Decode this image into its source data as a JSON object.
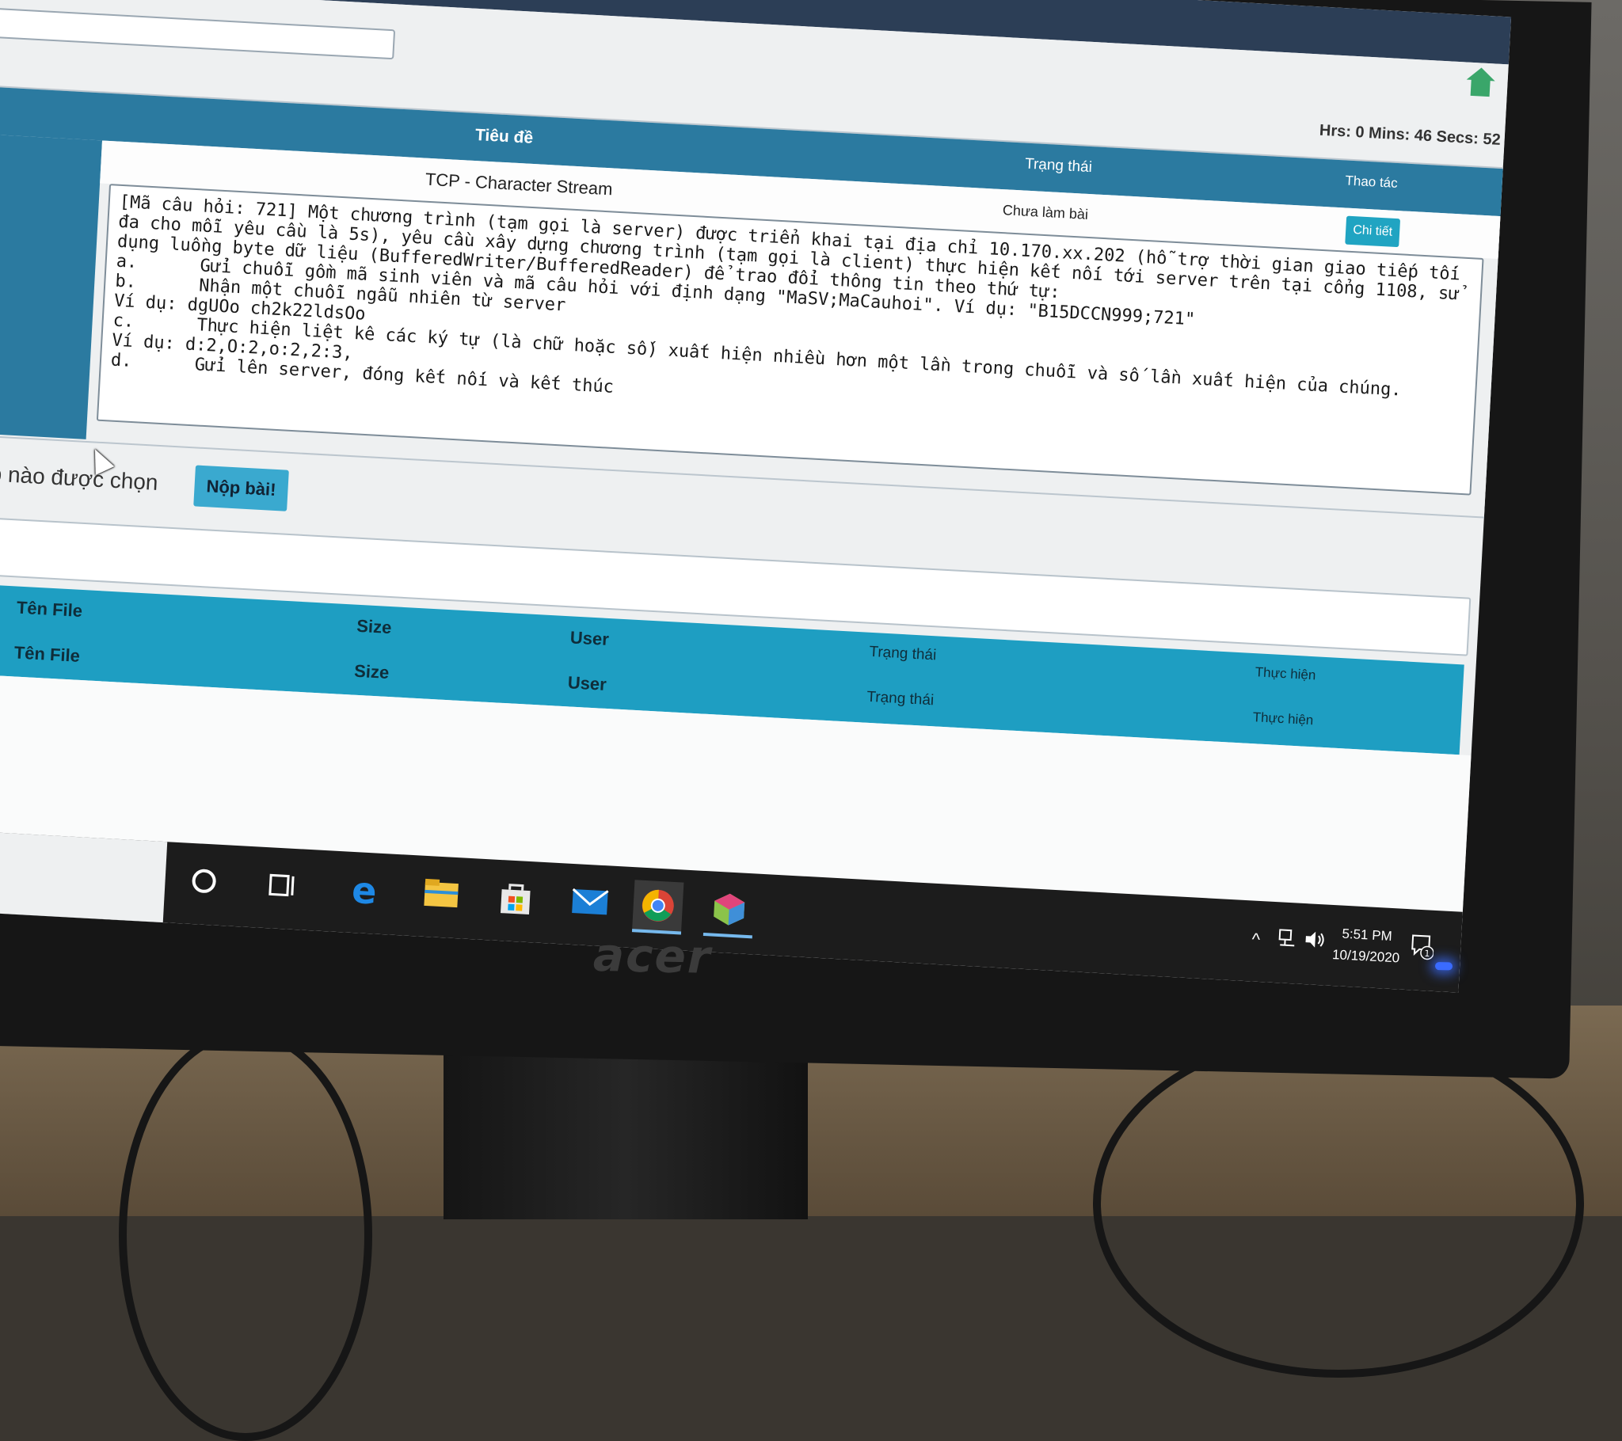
{
  "monitor": {
    "brand": "acer"
  },
  "page": {
    "timer": "Hrs: 0 Mins: 46 Secs: 52",
    "questions_table": {
      "columns": {
        "title": "Tiêu đề",
        "status": "Trạng thái",
        "action": "Thao tác"
      },
      "row": {
        "title": "TCP - Character Stream",
        "status": "Chưa làm bài",
        "detail_button": "Chi tiết"
      },
      "description": "[Mã câu hỏi: 721] Một chương trình (tạm gọi là server) được triển khai tại địa chỉ 10.170.xx.202 (hỗ trợ thời gian giao tiếp tối đa cho mỗi yêu cầu là 5s), yêu cầu xây dựng chương trình (tạm gọi là client) thực hiện kết nối tới server trên tại cổng 1108, sử dụng luồng byte dữ liệu (BufferedWriter/BufferedReader) để trao đổi thông tin theo thứ tự:\na.      Gửi chuỗi gồm mã sinh viên và mã câu hỏi với định dạng \"MaSV;MaCauhoi\". Ví dụ: \"B15DCCN999;721\"\nb.      Nhận một chuỗi ngẫu nhiên từ server\nVí dụ: dgUOo ch2k22ldsOo\nc.      Thực hiện liệt kê các ký tự (là chữ hoặc số) xuất hiện nhiều hơn một lần trong chuỗi và số lần xuất hiện của chúng.\nVí dụ: d:2,O:2,o:2,2:3,\nd.      Gửi lên server, đóng kết nối và kết thúc"
    },
    "upload": {
      "file_status": "có tệp nào được chọn",
      "submit_button": "Nộp bài!"
    },
    "files_table": {
      "header_rows": [
        {
          "file": "Tên File",
          "size": "Size",
          "user": "User",
          "status": "Trạng thái",
          "action": "Thực hiện"
        },
        {
          "file": "Tên File",
          "size": "Size",
          "user": "User",
          "status": "Trạng thái",
          "action": "Thực hiện"
        }
      ]
    }
  },
  "taskbar": {
    "items": [
      "cortana-circle-icon",
      "task-view-icon",
      "edge-icon",
      "file-explorer-icon",
      "store-icon",
      "mail-icon",
      "chrome-icon",
      "ide-cube-icon"
    ],
    "active_item": "chrome-icon",
    "time": "5:51 PM",
    "date": "10/19/2020",
    "notification_count": "1"
  },
  "colors": {
    "header_blue": "#2b7aa0",
    "table_cyan": "#1e9ec2",
    "button_cyan": "#3aa9cf"
  }
}
